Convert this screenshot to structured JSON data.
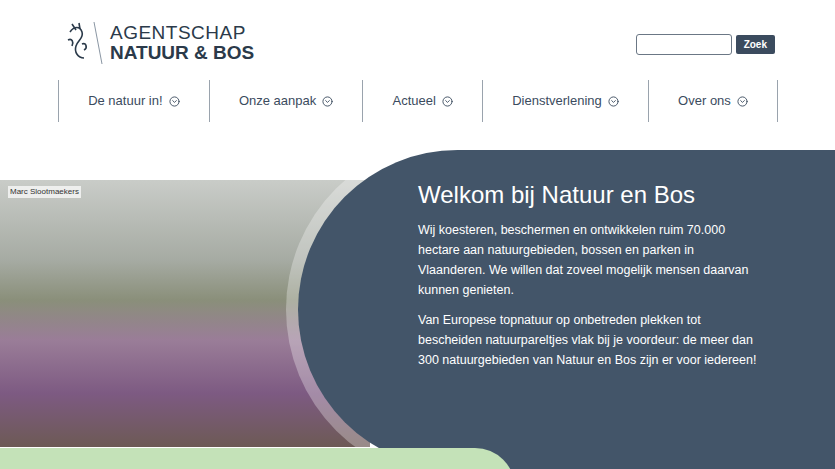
{
  "header": {
    "logo": {
      "line1": "AGENTSCHAP",
      "line2": "NATUUR & BOS"
    },
    "search": {
      "placeholder": "",
      "button": "Zoek"
    }
  },
  "nav": [
    {
      "label": "De natuur in!"
    },
    {
      "label": "Onze aanpak"
    },
    {
      "label": "Actueel"
    },
    {
      "label": "Dienstverlening"
    },
    {
      "label": "Over ons"
    }
  ],
  "hero": {
    "photo_credit": "Marc Slootmaekers",
    "title": "Welkom bij Natuur en Bos",
    "paragraphs": [
      "Wij koesteren, beschermen en ontwikkelen ruim 70.000 hectare aan natuurgebieden, bossen en parken in Vlaanderen. We willen dat zoveel mogelijk mensen daarvan kunnen genieten.",
      "Van Europese topnatuur op onbetreden plekken tot bescheiden natuurpareltjes vlak bij je voordeur: de meer dan 300 natuurgebieden van Natuur en Bos zijn er voor iedereen!"
    ]
  }
}
